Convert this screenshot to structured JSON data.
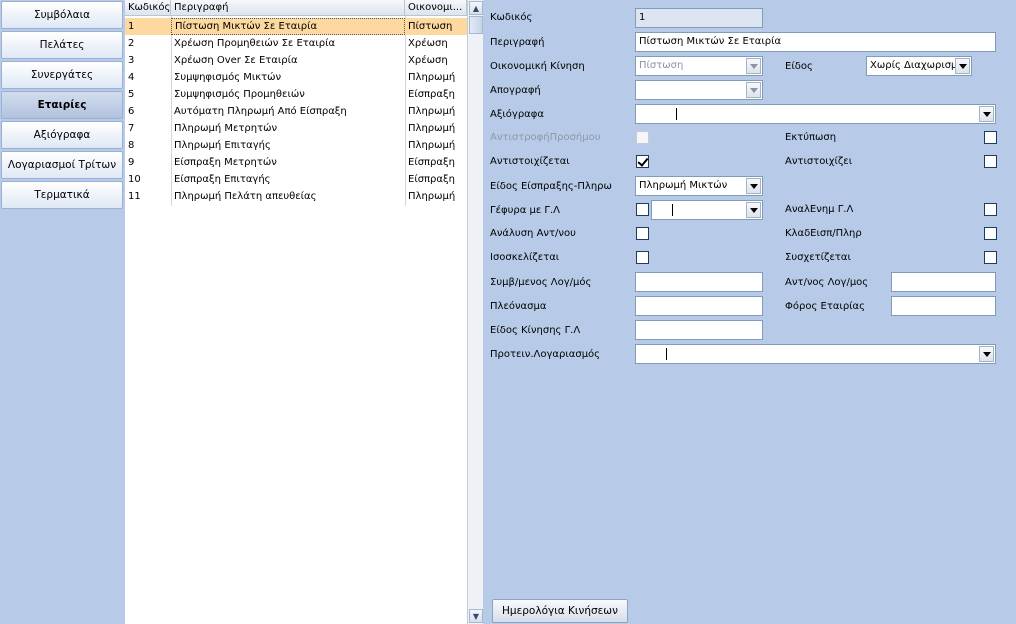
{
  "sidebar": {
    "items": [
      {
        "label": "Συμβόλαια"
      },
      {
        "label": "Πελάτες"
      },
      {
        "label": "Συνεργάτες"
      },
      {
        "label": "Εταιρίες"
      },
      {
        "label": "Αξιόγραφα"
      },
      {
        "label": "Λογαριασμοί Τρίτων"
      },
      {
        "label": "Τερματικά"
      }
    ],
    "active": "Εταιρίες"
  },
  "grid": {
    "columns": [
      "Κωδικός",
      "Περιγραφή",
      "Οικονομι..."
    ],
    "rows": [
      {
        "code": "1",
        "description": "Πίστωση Μικτών Σε Εταιρία",
        "movement": "Πίστωση"
      },
      {
        "code": "2",
        "description": "Χρέωση Προμηθειών Σε Εταιρία",
        "movement": "Χρέωση"
      },
      {
        "code": "3",
        "description": "Χρέωση Over Σε Εταιρία",
        "movement": "Χρέωση"
      },
      {
        "code": "4",
        "description": "Συμψηφισμός Μικτών",
        "movement": "Πληρωμή"
      },
      {
        "code": "5",
        "description": "Συμψηφισμός Προμηθειών",
        "movement": "Είσπραξη"
      },
      {
        "code": "6",
        "description": "Αυτόματη Πληρωμή Από Είσπραξη",
        "movement": "Πληρωμή"
      },
      {
        "code": "7",
        "description": "Πληρωμή Μετρητών",
        "movement": "Πληρωμή"
      },
      {
        "code": "8",
        "description": "Πληρωμή Επιταγής",
        "movement": "Πληρωμή"
      },
      {
        "code": "9",
        "description": "Είσπραξη Μετρητών",
        "movement": "Είσπραξη"
      },
      {
        "code": "10",
        "description": "Είσπραξη Επιταγής",
        "movement": "Είσπραξη"
      },
      {
        "code": "11",
        "description": "Πληρωμή Πελάτη απευθείας",
        "movement": "Πληρωμή"
      }
    ]
  },
  "form": {
    "code": {
      "label": "Κωδικός",
      "value": "1"
    },
    "description": {
      "label": "Περιγραφή",
      "value": "Πίστωση Μικτών Σε Εταιρία"
    },
    "economic_movement": {
      "label": "Οικονομική Κίνηση",
      "value": "Πίστωση"
    },
    "type": {
      "label": "Είδος",
      "value": "Χωρίς Διαχωρισμό"
    },
    "inventory": {
      "label": "Απογραφή",
      "value": ""
    },
    "securities": {
      "label": "Αξιόγραφα",
      "value": ""
    },
    "sign_reversal": {
      "label": "ΑντιστροφήΠροσήμου",
      "checked": false,
      "enabled": false
    },
    "print": {
      "label": "Εκτύπωση",
      "checked": false
    },
    "is_matched": {
      "label": "Αντιστοιχίζεται",
      "checked": true
    },
    "matches": {
      "label": "Αντιστοιχίζει",
      "checked": false
    },
    "collection_type": {
      "label": "Είδος Είσπραξης-Πληρω",
      "value": "Πληρωμή Μικτών"
    },
    "gl_bridge": {
      "label": "Γέφυρα με Γ.Λ",
      "checked": false,
      "value": ""
    },
    "gl_update": {
      "label": "ΑναλΕνημ Γ.Λ",
      "checked": false
    },
    "analysis": {
      "label": "Ανάλυση Αντ/νου",
      "checked": false
    },
    "branch_payment": {
      "label": "ΚλαδΕισπ/Πληρ",
      "checked": false
    },
    "is_balanced": {
      "label": "Ισοσκελίζεται",
      "checked": false
    },
    "is_related": {
      "label": "Συσχετίζεται",
      "checked": false
    },
    "contract_account": {
      "label": "Συμβ/μενος Λογ/μός",
      "value": ""
    },
    "counter_account": {
      "label": "Αντ/νος Λογ/μος",
      "value": ""
    },
    "surplus": {
      "label": "Πλεόνασμα",
      "value": ""
    },
    "company_tax": {
      "label": "Φόρος Εταιρίας",
      "value": ""
    },
    "gl_movement_type": {
      "label": "Είδος Κίνησης Γ.Λ",
      "value": ""
    },
    "suggested_account": {
      "label": "Προτειν.Λογαριασμός",
      "value": ""
    }
  },
  "footer": {
    "journal_button": "Ημερολόγια Κινήσεων"
  }
}
